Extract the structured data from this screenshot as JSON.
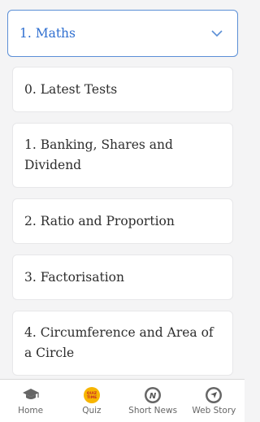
{
  "dropdown": {
    "selected": "1. Maths"
  },
  "topics": [
    {
      "label": "0. Latest Tests"
    },
    {
      "label": "1. Banking, Shares and Dividend"
    },
    {
      "label": "2. Ratio and Proportion"
    },
    {
      "label": "3. Factorisation"
    },
    {
      "label": "4. Circumference and Area of a Circle"
    }
  ],
  "nav": {
    "home": "Home",
    "quiz": "Quiz",
    "quiz_icon_text": "QUIZ TIME",
    "short_news": "Short News",
    "short_news_icon_text": "N",
    "web_story": "Web Story"
  },
  "colors": {
    "accent": "#2f6fd0",
    "border_accent": "#5b8fd6",
    "quiz_icon": "#f7b500"
  }
}
